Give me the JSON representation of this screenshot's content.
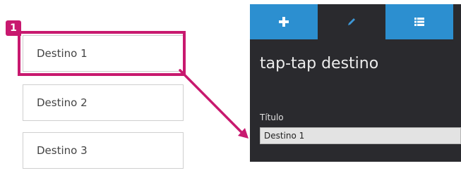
{
  "destinations": [
    {
      "label": "Destino 1"
    },
    {
      "label": "Destino 2"
    },
    {
      "label": "Destino 3"
    }
  ],
  "annotation": {
    "step_number": "1",
    "color": "#c8196f"
  },
  "panel": {
    "tabs": [
      {
        "icon": "plus-icon",
        "active": false
      },
      {
        "icon": "pencil-icon",
        "active": true
      },
      {
        "icon": "list-icon",
        "active": false
      }
    ],
    "tab_color": "#2c8fd0",
    "background": "#2a2a2e",
    "title": "tap-tap destino",
    "field_label": "Título",
    "field_value": "Destino 1"
  }
}
